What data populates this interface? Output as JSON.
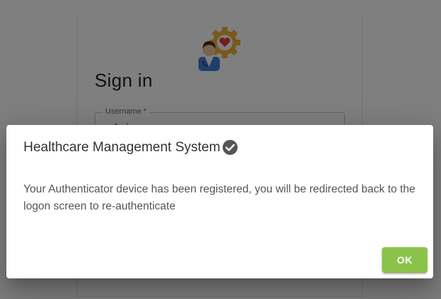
{
  "login": {
    "logo_icon": "doctor-gear-heart-icon",
    "title": "Sign in",
    "username_label": "Username *",
    "username_value": "admin"
  },
  "dialog": {
    "title": "Healthcare Management System",
    "title_icon": "check-circle-icon",
    "message": "Your Authenticator device has been registered, you will be redirected back to the logon screen to re-authenticate",
    "ok_label": "OK"
  },
  "colors": {
    "accent": "#8bc34a",
    "backdrop": "rgba(0,0,0,0.5)"
  }
}
